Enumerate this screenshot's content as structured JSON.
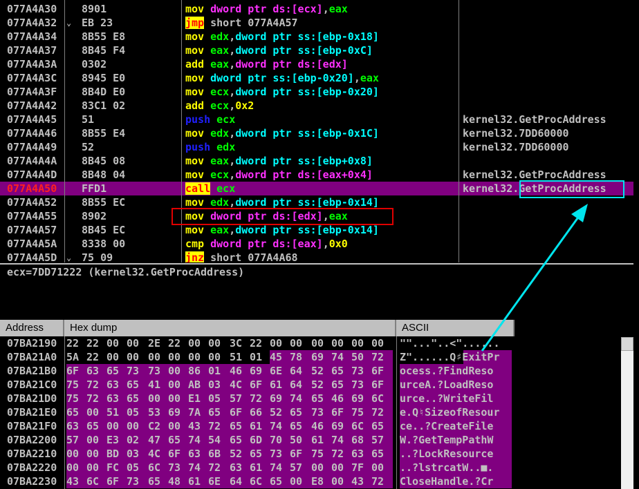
{
  "disasm": {
    "rows": [
      {
        "addr": "077A4A30",
        "mark": "",
        "hex": "8901",
        "tokens": [
          [
            "kw-mov",
            "mov "
          ],
          [
            "sz",
            "dword ptr ds:[ecx]"
          ],
          [
            "plain",
            ","
          ],
          [
            "reg",
            "eax"
          ]
        ],
        "cmt": ""
      },
      {
        "addr": "077A4A32",
        "mark": "⌄",
        "hex": "EB 23",
        "tokens": [
          [
            "kw-jmp",
            "jmp"
          ],
          [
            "plain",
            " short 077A4A57"
          ]
        ],
        "cmt": ""
      },
      {
        "addr": "077A4A34",
        "mark": "",
        "hex": "8B55 E8",
        "tokens": [
          [
            "kw-mov",
            "mov "
          ],
          [
            "reg",
            "edx"
          ],
          [
            "plain",
            ","
          ],
          [
            "sz-op",
            "dword ptr ss:[ebp-0x18]"
          ]
        ],
        "cmt": ""
      },
      {
        "addr": "077A4A37",
        "mark": "",
        "hex": "8B45 F4",
        "tokens": [
          [
            "kw-mov",
            "mov "
          ],
          [
            "reg",
            "eax"
          ],
          [
            "plain",
            ","
          ],
          [
            "sz-op",
            "dword ptr ss:[ebp-0xC]"
          ]
        ],
        "cmt": ""
      },
      {
        "addr": "077A4A3A",
        "mark": "",
        "hex": "0302",
        "tokens": [
          [
            "kw-mov",
            "add "
          ],
          [
            "reg",
            "eax"
          ],
          [
            "plain",
            ","
          ],
          [
            "sz",
            "dword ptr ds:[edx]"
          ]
        ],
        "cmt": ""
      },
      {
        "addr": "077A4A3C",
        "mark": "",
        "hex": "8945 E0",
        "tokens": [
          [
            "kw-mov",
            "mov "
          ],
          [
            "sz-op",
            "dword ptr ss:[ebp-0x20]"
          ],
          [
            "plain",
            ","
          ],
          [
            "reg",
            "eax"
          ]
        ],
        "cmt": ""
      },
      {
        "addr": "077A4A3F",
        "mark": "",
        "hex": "8B4D E0",
        "tokens": [
          [
            "kw-mov",
            "mov "
          ],
          [
            "reg",
            "ecx"
          ],
          [
            "plain",
            ","
          ],
          [
            "sz-op",
            "dword ptr ss:[ebp-0x20]"
          ]
        ],
        "cmt": ""
      },
      {
        "addr": "077A4A42",
        "mark": "",
        "hex": "83C1 02",
        "tokens": [
          [
            "kw-mov",
            "add "
          ],
          [
            "reg",
            "ecx"
          ],
          [
            "plain",
            ","
          ],
          [
            "num",
            "0x2"
          ]
        ],
        "cmt": ""
      },
      {
        "addr": "077A4A45",
        "mark": "",
        "hex": "51",
        "tokens": [
          [
            "kw-push",
            "push "
          ],
          [
            "reg",
            "ecx"
          ]
        ],
        "cmt": "kernel32.GetProcAddress"
      },
      {
        "addr": "077A4A46",
        "mark": "",
        "hex": "8B55 E4",
        "tokens": [
          [
            "kw-mov",
            "mov "
          ],
          [
            "reg",
            "edx"
          ],
          [
            "plain",
            ","
          ],
          [
            "sz-op",
            "dword ptr ss:[ebp-0x1C]"
          ]
        ],
        "cmt": "kernel32.7DD60000"
      },
      {
        "addr": "077A4A49",
        "mark": "",
        "hex": "52",
        "tokens": [
          [
            "kw-push",
            "push "
          ],
          [
            "reg",
            "edx"
          ]
        ],
        "cmt": "kernel32.7DD60000"
      },
      {
        "addr": "077A4A4A",
        "mark": "",
        "hex": "8B45 08",
        "tokens": [
          [
            "kw-mov",
            "mov "
          ],
          [
            "reg",
            "eax"
          ],
          [
            "plain",
            ","
          ],
          [
            "sz-op",
            "dword ptr ss:[ebp+0x8]"
          ]
        ],
        "cmt": ""
      },
      {
        "addr": "077A4A4D",
        "mark": "",
        "hex": "8B48 04",
        "tokens": [
          [
            "kw-mov",
            "mov "
          ],
          [
            "reg",
            "ecx"
          ],
          [
            "plain",
            ","
          ],
          [
            "sz",
            "dword ptr ds:[eax+0x4]"
          ]
        ],
        "cmt": "kernel32.GetProcAddress"
      },
      {
        "addr": "077A4A50",
        "mark": "",
        "hex": "FFD1",
        "tokens": [
          [
            "kw-call",
            "call"
          ],
          [
            "plain",
            " "
          ],
          [
            "reg",
            "ecx"
          ]
        ],
        "cmt": "kernel32.GetProcAddress",
        "selected": true
      },
      {
        "addr": "077A4A52",
        "mark": "",
        "hex": "8B55 EC",
        "tokens": [
          [
            "kw-mov",
            "mov "
          ],
          [
            "reg",
            "edx"
          ],
          [
            "plain",
            ","
          ],
          [
            "sz-op",
            "dword ptr ss:[ebp-0x14]"
          ]
        ],
        "cmt": ""
      },
      {
        "addr": "077A4A55",
        "mark": "",
        "hex": "8902",
        "tokens": [
          [
            "kw-mov",
            "mov "
          ],
          [
            "sz",
            "dword ptr ds:[edx]"
          ],
          [
            "plain",
            ","
          ],
          [
            "reg",
            "eax"
          ]
        ],
        "cmt": ""
      },
      {
        "addr": "077A4A57",
        "mark": "",
        "hex": "8B45 EC",
        "tokens": [
          [
            "kw-mov",
            "mov "
          ],
          [
            "reg",
            "eax"
          ],
          [
            "plain",
            ","
          ],
          [
            "sz-op",
            "dword ptr ss:[ebp-0x14]"
          ]
        ],
        "cmt": ""
      },
      {
        "addr": "077A4A5A",
        "mark": "",
        "hex": "8338 00",
        "tokens": [
          [
            "kw-cmp",
            "cmp "
          ],
          [
            "sz",
            "dword ptr ds:[eax]"
          ],
          [
            "plain",
            ","
          ],
          [
            "num",
            "0x0"
          ]
        ],
        "cmt": ""
      },
      {
        "addr": "077A4A5D",
        "mark": "⌄",
        "hex": "75 09",
        "tokens": [
          [
            "kw-jmp",
            "jnz"
          ],
          [
            "plain",
            " short 077A4A68"
          ]
        ],
        "cmt": ""
      }
    ]
  },
  "info": {
    "text": "ecx=7DD71222 (kernel32.GetProcAddress)"
  },
  "dump": {
    "headers": {
      "address": "Address",
      "hex": "Hex dump",
      "ascii": "ASCII"
    },
    "rows": [
      {
        "addr": "07BA2190",
        "bytes": [
          "22",
          "22",
          "00",
          "00",
          "2E",
          "22",
          "00",
          "00",
          "3C",
          "22",
          "00",
          "00",
          "00",
          "00",
          "00",
          "00"
        ],
        "hlFrom": 16,
        "ascii": "\"\"...\"..<\"......",
        "asciiHl": "none"
      },
      {
        "addr": "07BA21A0",
        "bytes": [
          "5A",
          "22",
          "00",
          "00",
          "00",
          "00",
          "00",
          "00",
          "51",
          "01",
          "45",
          "78",
          "69",
          "74",
          "50",
          "72"
        ],
        "hlFrom": 10,
        "ascii": "Z\"......Q♯ExitPr",
        "asciiHl": "partial"
      },
      {
        "addr": "07BA21B0",
        "bytes": [
          "6F",
          "63",
          "65",
          "73",
          "73",
          "00",
          "86",
          "01",
          "46",
          "69",
          "6E",
          "64",
          "52",
          "65",
          "73",
          "6F"
        ],
        "hlFrom": 0,
        "ascii": "ocess.?FindReso",
        "asciiHl": "full"
      },
      {
        "addr": "07BA21C0",
        "bytes": [
          "75",
          "72",
          "63",
          "65",
          "41",
          "00",
          "AB",
          "03",
          "4C",
          "6F",
          "61",
          "64",
          "52",
          "65",
          "73",
          "6F"
        ],
        "hlFrom": 0,
        "ascii": "urceA.?LoadReso",
        "asciiHl": "full"
      },
      {
        "addr": "07BA21D0",
        "bytes": [
          "75",
          "72",
          "63",
          "65",
          "00",
          "00",
          "E1",
          "05",
          "57",
          "72",
          "69",
          "74",
          "65",
          "46",
          "69",
          "6C"
        ],
        "hlFrom": 0,
        "ascii": "urce..?WriteFil",
        "asciiHl": "full"
      },
      {
        "addr": "07BA21E0",
        "bytes": [
          "65",
          "00",
          "51",
          "05",
          "53",
          "69",
          "7A",
          "65",
          "6F",
          "66",
          "52",
          "65",
          "73",
          "6F",
          "75",
          "72"
        ],
        "hlFrom": 0,
        "ascii": "e.Q♮SizeofResour",
        "asciiHl": "full"
      },
      {
        "addr": "07BA21F0",
        "bytes": [
          "63",
          "65",
          "00",
          "00",
          "C2",
          "00",
          "43",
          "72",
          "65",
          "61",
          "74",
          "65",
          "46",
          "69",
          "6C",
          "65"
        ],
        "hlFrom": 0,
        "ascii": "ce..?CreateFile",
        "asciiHl": "full"
      },
      {
        "addr": "07BA2200",
        "bytes": [
          "57",
          "00",
          "E3",
          "02",
          "47",
          "65",
          "74",
          "54",
          "65",
          "6D",
          "70",
          "50",
          "61",
          "74",
          "68",
          "57"
        ],
        "hlFrom": 0,
        "ascii": "W.?GetTempPathW",
        "asciiHl": "full"
      },
      {
        "addr": "07BA2210",
        "bytes": [
          "00",
          "00",
          "BD",
          "03",
          "4C",
          "6F",
          "63",
          "6B",
          "52",
          "65",
          "73",
          "6F",
          "75",
          "72",
          "63",
          "65"
        ],
        "hlFrom": 0,
        "ascii": "..?LockResource",
        "asciiHl": "full"
      },
      {
        "addr": "07BA2220",
        "bytes": [
          "00",
          "00",
          "FC",
          "05",
          "6C",
          "73",
          "74",
          "72",
          "63",
          "61",
          "74",
          "57",
          "00",
          "00",
          "7F",
          "00"
        ],
        "hlFrom": 0,
        "ascii": "..?lstrcatW..■.",
        "asciiHl": "full"
      },
      {
        "addr": "07BA2230",
        "bytes": [
          "43",
          "6C",
          "6F",
          "73",
          "65",
          "48",
          "61",
          "6E",
          "64",
          "6C",
          "65",
          "00",
          "E8",
          "00",
          "43",
          "72"
        ],
        "hlFrom": 0,
        "ascii": "CloseHandle.?Cr",
        "asciiHl": "full"
      }
    ]
  },
  "colors": {
    "highlight": "#800080",
    "annotation_red": "#e00000",
    "annotation_cyan": "#00e5ee"
  }
}
